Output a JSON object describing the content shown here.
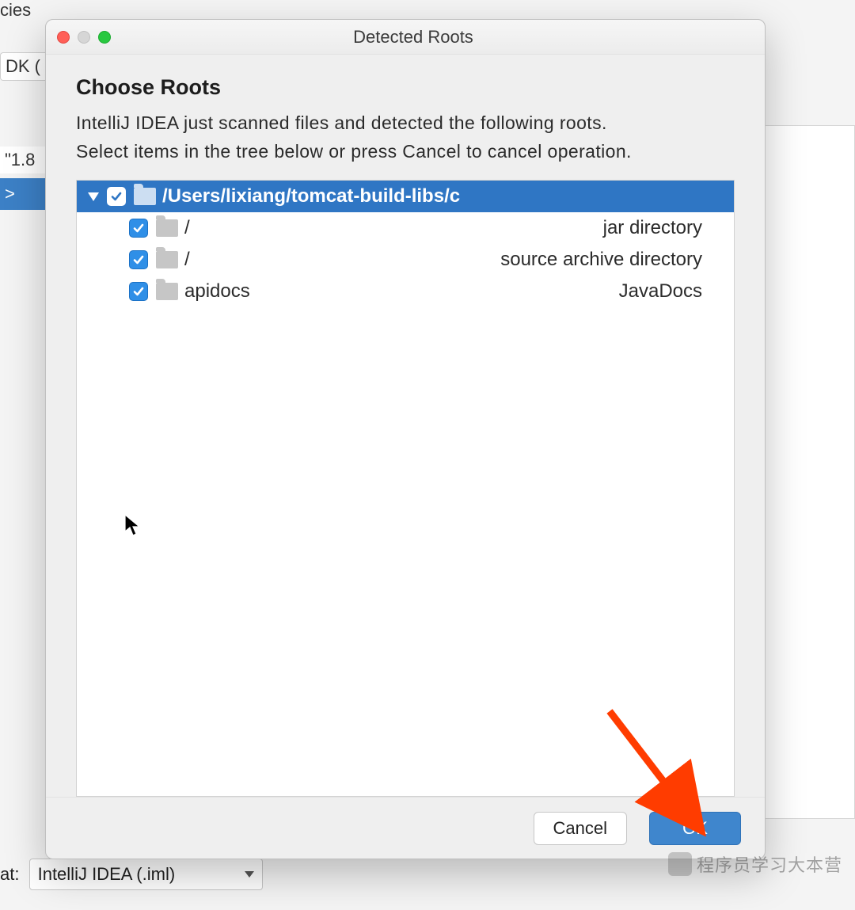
{
  "background": {
    "tab_fragment": "cies",
    "dk_label": "DK (",
    "version_label": "\"1.8",
    "selected_fragment": ">",
    "format_label": "at:",
    "format_select_value": "IntelliJ IDEA (.iml)"
  },
  "dialog": {
    "title": "Detected Roots",
    "heading": "Choose Roots",
    "description_line1": "IntelliJ IDEA just scanned files and detected the following roots.",
    "description_line2": "Select items in the tree below or press Cancel to cancel operation.",
    "tree": {
      "root": {
        "checked": true,
        "path": "/Users/lixiang/tomcat-build-libs/c"
      },
      "children": [
        {
          "checked": true,
          "name": "/",
          "type": "jar directory"
        },
        {
          "checked": true,
          "name": "/",
          "type": "source archive directory"
        },
        {
          "checked": true,
          "name": "apidocs",
          "type": "JavaDocs"
        }
      ]
    },
    "buttons": {
      "cancel": "Cancel",
      "ok": "OK"
    }
  },
  "watermark": "程序员学习大本营"
}
